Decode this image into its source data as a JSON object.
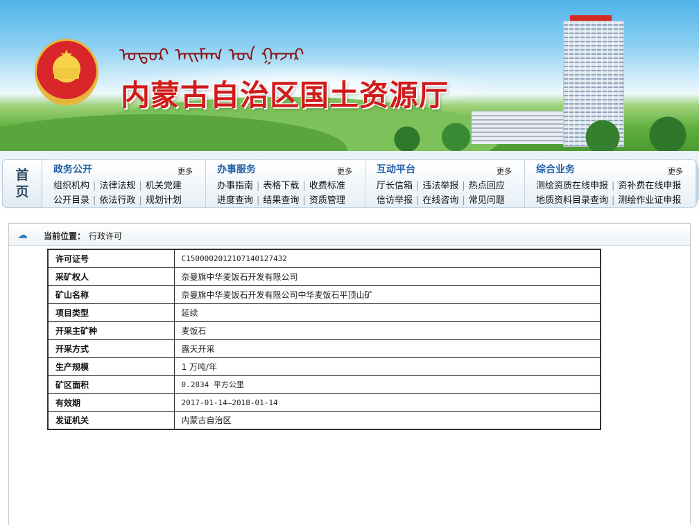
{
  "banner": {
    "mongolian_script": "ᠤᠳᠤᠷ ᠠᠢᠮᠠᠭ ᠤᠨ ᠭᠠᠵᠠᠷ",
    "site_title": "内蒙古自治区国土资源厅"
  },
  "nav": {
    "home_chars": [
      "首",
      "页"
    ],
    "more_label": "更多",
    "sections": [
      {
        "title": "政务公开",
        "row1": [
          "组织机构",
          "法律法规",
          "机关党建"
        ],
        "row2": [
          "公开目录",
          "依法行政",
          "规划计划"
        ]
      },
      {
        "title": "办事服务",
        "row1": [
          "办事指南",
          "表格下载",
          "收费标准"
        ],
        "row2": [
          "进度查询",
          "结果查询",
          "资质管理"
        ]
      },
      {
        "title": "互动平台",
        "row1": [
          "厅长信箱",
          "违法举报",
          "热点回应"
        ],
        "row2": [
          "信访举报",
          "在线咨询",
          "常见问题"
        ]
      },
      {
        "title": "综合业务",
        "row1": [
          "测绘资质在线申报",
          "资补费在线申报"
        ],
        "row2": [
          "地质资料目录查询",
          "测绘作业证申报"
        ]
      }
    ]
  },
  "breadcrumb": {
    "label": "当前位置：",
    "value": "行政许可"
  },
  "license": {
    "rows": [
      {
        "key": "许可证号",
        "value": "C1500002012107140127432"
      },
      {
        "key": "采矿权人",
        "value": "奈曼旗中华麦饭石开发有限公司"
      },
      {
        "key": "矿山名称",
        "value": "奈曼旗中华麦饭石开发有限公司中华麦饭石平顶山矿"
      },
      {
        "key": "项目类型",
        "value": "延续"
      },
      {
        "key": "开采主矿种",
        "value": "麦饭石"
      },
      {
        "key": "开采方式",
        "value": "露天开采"
      },
      {
        "key": "生产规模",
        "value": "1 万吨/年"
      },
      {
        "key": "矿区面积",
        "value": "0.2834 平方公里"
      },
      {
        "key": "有效期",
        "value": "2017-01-14—2018-01-14"
      },
      {
        "key": "发证机关",
        "value": "内蒙古自治区"
      }
    ]
  }
}
